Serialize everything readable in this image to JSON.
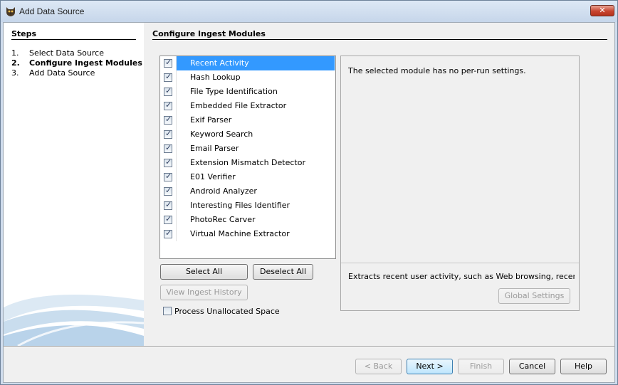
{
  "window": {
    "title": "Add Data Source",
    "close_label": "✕"
  },
  "steps": {
    "title": "Steps",
    "items": [
      {
        "num": "1.",
        "label": "Select Data Source"
      },
      {
        "num": "2.",
        "label": "Configure Ingest Modules"
      },
      {
        "num": "3.",
        "label": "Add Data Source"
      }
    ],
    "active_index": 1
  },
  "section": {
    "title": "Configure Ingest Modules"
  },
  "modules": [
    {
      "label": "Recent Activity",
      "checked": true,
      "selected": true
    },
    {
      "label": "Hash Lookup",
      "checked": true
    },
    {
      "label": "File Type Identification",
      "checked": true
    },
    {
      "label": "Embedded File Extractor",
      "checked": true
    },
    {
      "label": "Exif Parser",
      "checked": true
    },
    {
      "label": "Keyword Search",
      "checked": true
    },
    {
      "label": "Email Parser",
      "checked": true
    },
    {
      "label": "Extension Mismatch Detector",
      "checked": true
    },
    {
      "label": "E01 Verifier",
      "checked": true
    },
    {
      "label": "Android Analyzer",
      "checked": true
    },
    {
      "label": "Interesting Files Identifier",
      "checked": true
    },
    {
      "label": "PhotoRec Carver",
      "checked": true
    },
    {
      "label": "Virtual Machine Extractor",
      "checked": true
    }
  ],
  "buttons": {
    "select_all": "Select All",
    "deselect_all": "Deselect All",
    "view_history": "View Ingest History",
    "global_settings": "Global Settings",
    "back": "< Back",
    "next": "Next >",
    "finish": "Finish",
    "cancel": "Cancel",
    "help": "Help"
  },
  "unallocated": {
    "label": "Process Unallocated Space",
    "checked": false
  },
  "settings": {
    "message": "The selected module has no per-run settings.",
    "description": "Extracts recent user activity, such as Web browsing, recently ..."
  },
  "colors": {
    "selection": "#3399ff",
    "window_frame": "#cfdcec"
  },
  "icons": {
    "app": "sleuth-dog-icon",
    "checkbox": "checkmark-icon"
  }
}
